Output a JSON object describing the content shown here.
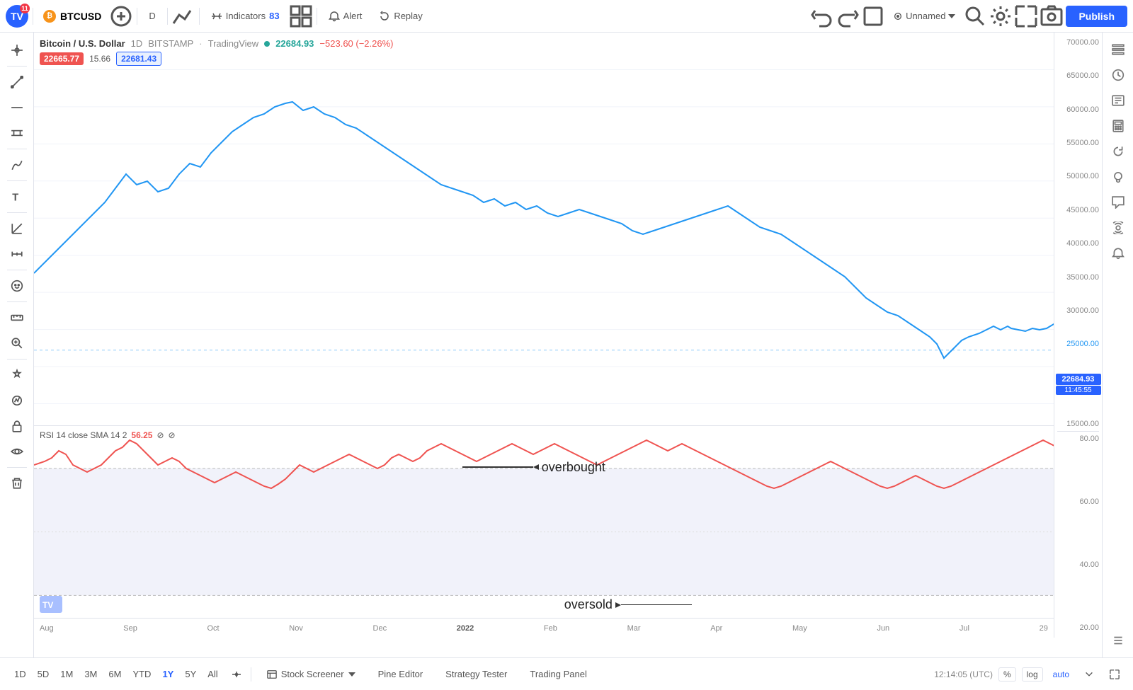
{
  "toolbar": {
    "logo_label": "TV",
    "notif_count": "11",
    "symbol": "BTCUSD",
    "timeframe": "D",
    "indicators_label": "Indicators",
    "indicators_count": "83",
    "alert_label": "Alert",
    "replay_label": "Replay",
    "chart_name": "Unnamed",
    "publish_label": "Publish"
  },
  "chart": {
    "symbol_full": "Bitcoin / U.S. Dollar",
    "timeframe": "1D",
    "exchange": "BITSTAMP",
    "source": "TradingView",
    "price": "22684.93",
    "change": "−523.60 (−2.26%)",
    "open": "22665.77",
    "prev_close_diff": "15.66",
    "close": "22681.43",
    "price_tag": "22684.93",
    "time_tag": "11:45:55",
    "currency": "USD",
    "y_labels": [
      "70000.00",
      "65000.00",
      "60000.00",
      "55000.00",
      "50000.00",
      "45000.00",
      "40000.00",
      "35000.00",
      "30000.00",
      "25000.00",
      "15000.00"
    ],
    "x_labels": [
      "Aug",
      "Sep",
      "Oct",
      "Nov",
      "Dec",
      "2022",
      "Feb",
      "Mar",
      "Apr",
      "May",
      "Jun",
      "Jul",
      "29"
    ]
  },
  "rsi": {
    "label": "RSI 14 close SMA 14 2",
    "value": "56.25",
    "y_labels": [
      "80.00",
      "60.00",
      "40.00",
      "20.00"
    ],
    "overbought_label": "overbought",
    "oversold_label": "oversold"
  },
  "timeframes": [
    {
      "label": "1D",
      "active": false
    },
    {
      "label": "5D",
      "active": false
    },
    {
      "label": "1M",
      "active": false
    },
    {
      "label": "3M",
      "active": false
    },
    {
      "label": "6M",
      "active": false
    },
    {
      "label": "YTD",
      "active": false
    },
    {
      "label": "1Y",
      "active": true
    },
    {
      "label": "5Y",
      "active": false
    },
    {
      "label": "All",
      "active": false
    }
  ],
  "bottom_tabs": [
    {
      "label": "Stock Screener",
      "active": false
    },
    {
      "label": "Pine Editor",
      "active": false
    },
    {
      "label": "Strategy Tester",
      "active": false
    },
    {
      "label": "Trading Panel",
      "active": false
    }
  ],
  "bottom_right": {
    "time": "12:14:05 (UTC)",
    "percent_label": "%",
    "log_label": "log",
    "auto_label": "auto"
  }
}
